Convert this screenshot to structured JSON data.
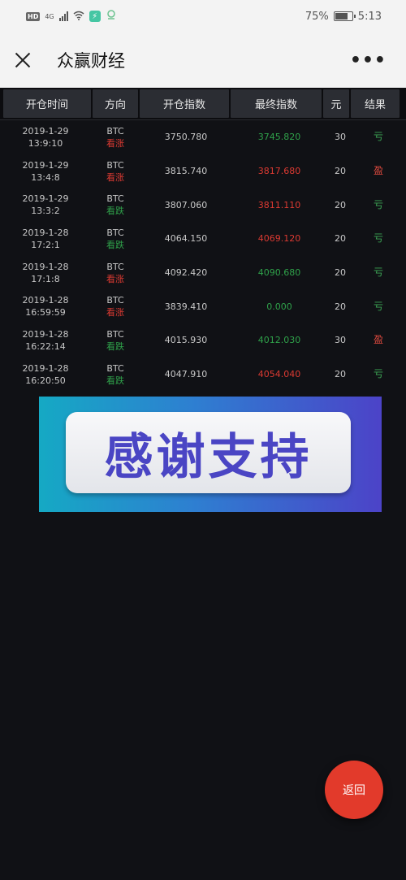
{
  "statusbar": {
    "hd": "HD",
    "network": "4G",
    "battery": "75%",
    "battery_level": 0.75,
    "time": "5:13"
  },
  "nav": {
    "title": "众赢财经",
    "more": "•••"
  },
  "table": {
    "headers": [
      "开仓时间",
      "方向",
      "开仓指数",
      "最终指数",
      "元",
      "结果"
    ],
    "rows": [
      {
        "date": "2019-1-29",
        "time": "13:9:10",
        "coin": "BTC",
        "dir": "看涨",
        "open": "3750.780",
        "final": "3745.820",
        "amount": "30",
        "result": "亏"
      },
      {
        "date": "2019-1-29",
        "time": "13:4:8",
        "coin": "BTC",
        "dir": "看涨",
        "open": "3815.740",
        "final": "3817.680",
        "amount": "20",
        "result": "盈"
      },
      {
        "date": "2019-1-29",
        "time": "13:3:2",
        "coin": "BTC",
        "dir": "看跌",
        "open": "3807.060",
        "final": "3811.110",
        "amount": "20",
        "result": "亏"
      },
      {
        "date": "2019-1-28",
        "time": "17:2:1",
        "coin": "BTC",
        "dir": "看跌",
        "open": "4064.150",
        "final": "4069.120",
        "amount": "20",
        "result": "亏"
      },
      {
        "date": "2019-1-28",
        "time": "17:1:8",
        "coin": "BTC",
        "dir": "看涨",
        "open": "4092.420",
        "final": "4090.680",
        "amount": "20",
        "result": "亏"
      },
      {
        "date": "2019-1-28",
        "time": "16:59:59",
        "coin": "BTC",
        "dir": "看涨",
        "open": "3839.410",
        "final": "0.000",
        "amount": "20",
        "result": "亏"
      },
      {
        "date": "2019-1-28",
        "time": "16:22:14",
        "coin": "BTC",
        "dir": "看跌",
        "open": "4015.930",
        "final": "4012.030",
        "amount": "30",
        "result": "盈"
      },
      {
        "date": "2019-1-28",
        "time": "16:20:50",
        "coin": "BTC",
        "dir": "看跌",
        "open": "4047.910",
        "final": "4054.040",
        "amount": "20",
        "result": "亏"
      }
    ]
  },
  "banner": {
    "text": "感谢支持"
  },
  "fab": {
    "label": "返回"
  },
  "colors": {
    "up": "#dc3a32",
    "down": "#2fa14a",
    "background": "#101115"
  }
}
